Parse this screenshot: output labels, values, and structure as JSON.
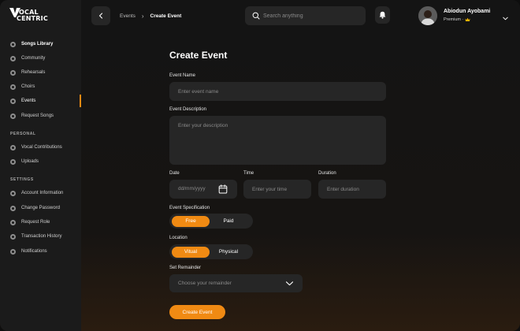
{
  "brand": {
    "logo_text_line1": "OCAL",
    "logo_text_line2": "CENTRIC",
    "accent_color": "#f08a13"
  },
  "sidebar": {
    "main_items": [
      {
        "label": "Songs Library",
        "icon": "music-note-icon"
      },
      {
        "label": "Community",
        "icon": "community-icon"
      },
      {
        "label": "Rehearsals",
        "icon": "rehearsal-icon"
      },
      {
        "label": "Choirs",
        "icon": "choir-icon"
      },
      {
        "label": "Events",
        "icon": "events-icon",
        "active": true
      },
      {
        "label": "Request Songs",
        "icon": "request-icon"
      }
    ],
    "personal_title": "PERSONAL",
    "personal_items": [
      {
        "label": "Vocal Contributions",
        "icon": "microphone-icon"
      },
      {
        "label": "Uploads",
        "icon": "upload-icon"
      }
    ],
    "settings_title": "SETTINGS",
    "settings_items": [
      {
        "label": "Account Information",
        "icon": "user-icon"
      },
      {
        "label": "Change Password",
        "icon": "lock-icon"
      },
      {
        "label": "Request Role",
        "icon": "role-icon"
      },
      {
        "label": "Transaction History",
        "icon": "history-icon"
      },
      {
        "label": "Notifications",
        "icon": "bell-icon"
      }
    ]
  },
  "header": {
    "breadcrumb": [
      "Events",
      "Create Event"
    ],
    "search_placeholder": "Search anything",
    "user_name": "Abiodun Ayobami",
    "user_plan": "Premium ·",
    "plan_icon": "crown-icon"
  },
  "form": {
    "title": "Create Event",
    "event_name_label": "Event Name",
    "event_name_placeholder": "Enter event name",
    "event_description_label": "Event Description",
    "event_description_placeholder": "Enter your description",
    "date_label": "Date",
    "date_placeholder": "dd/mm/yyyy",
    "time_label": "Time",
    "time_placeholder": "Enter your time",
    "duration_label": "Duration",
    "duration_placeholder": "Enter duration",
    "specification_label": "Event Specification",
    "specification_options": [
      "Free",
      "Paid"
    ],
    "specification_selected": "Free",
    "location_label": "Location",
    "location_options": [
      "Vitual",
      "Physical"
    ],
    "location_selected": "Vitual",
    "reminder_label": "Set Remainder",
    "reminder_placeholder": "Choose your remainder",
    "submit_label": "Create Event"
  }
}
